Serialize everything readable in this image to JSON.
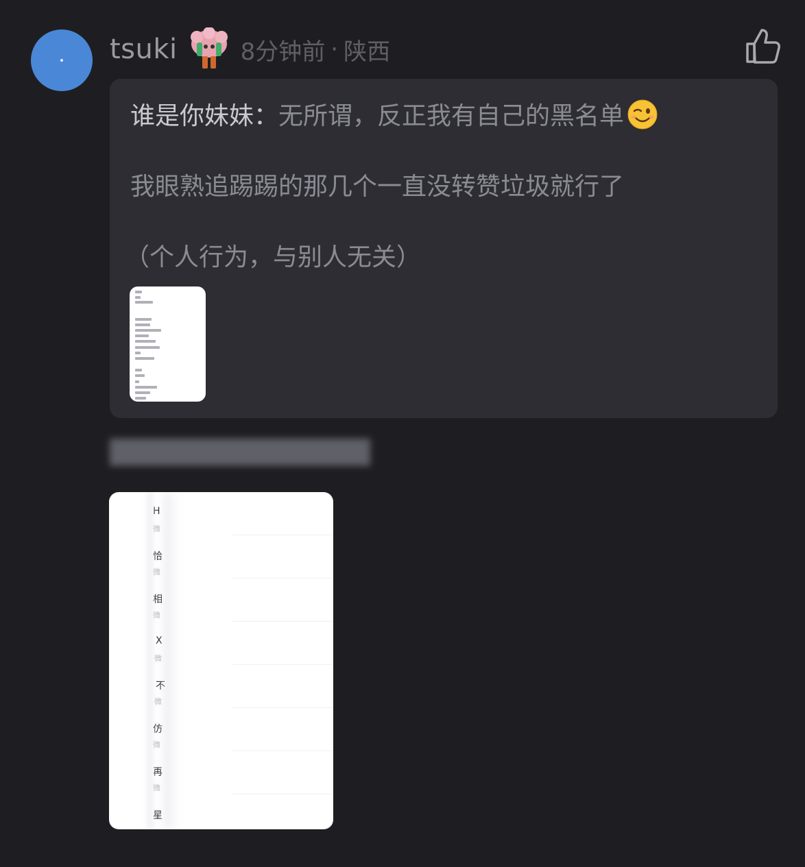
{
  "comment": {
    "username": "tsuki",
    "time": "8分钟前",
    "separator": "·",
    "location": "陕西",
    "badge_icon": "cartoon-character-badge",
    "avatar_color": "#4a87d7"
  },
  "quote": {
    "author": "谁是你妹妹：",
    "line1_text": "无所谓，反正我有自己的黑名单",
    "line1_emoji": "winking-face-emoji",
    "line2": "我眼熟追踢踢的那几个一直没转赞垃圾就行了",
    "line3": "（个人行为，与别人无关）"
  },
  "photo": {
    "rows": [
      {
        "title": "H",
        "sub": "微"
      },
      {
        "title": "恰",
        "sub": "微"
      },
      {
        "title": "相",
        "sub": "微"
      },
      {
        "title": "X",
        "sub": "微"
      },
      {
        "title": "不",
        "sub": "微"
      },
      {
        "title": "仿",
        "sub": "微"
      },
      {
        "title": "再",
        "sub": "微"
      },
      {
        "title": "星",
        "sub": ""
      }
    ]
  }
}
